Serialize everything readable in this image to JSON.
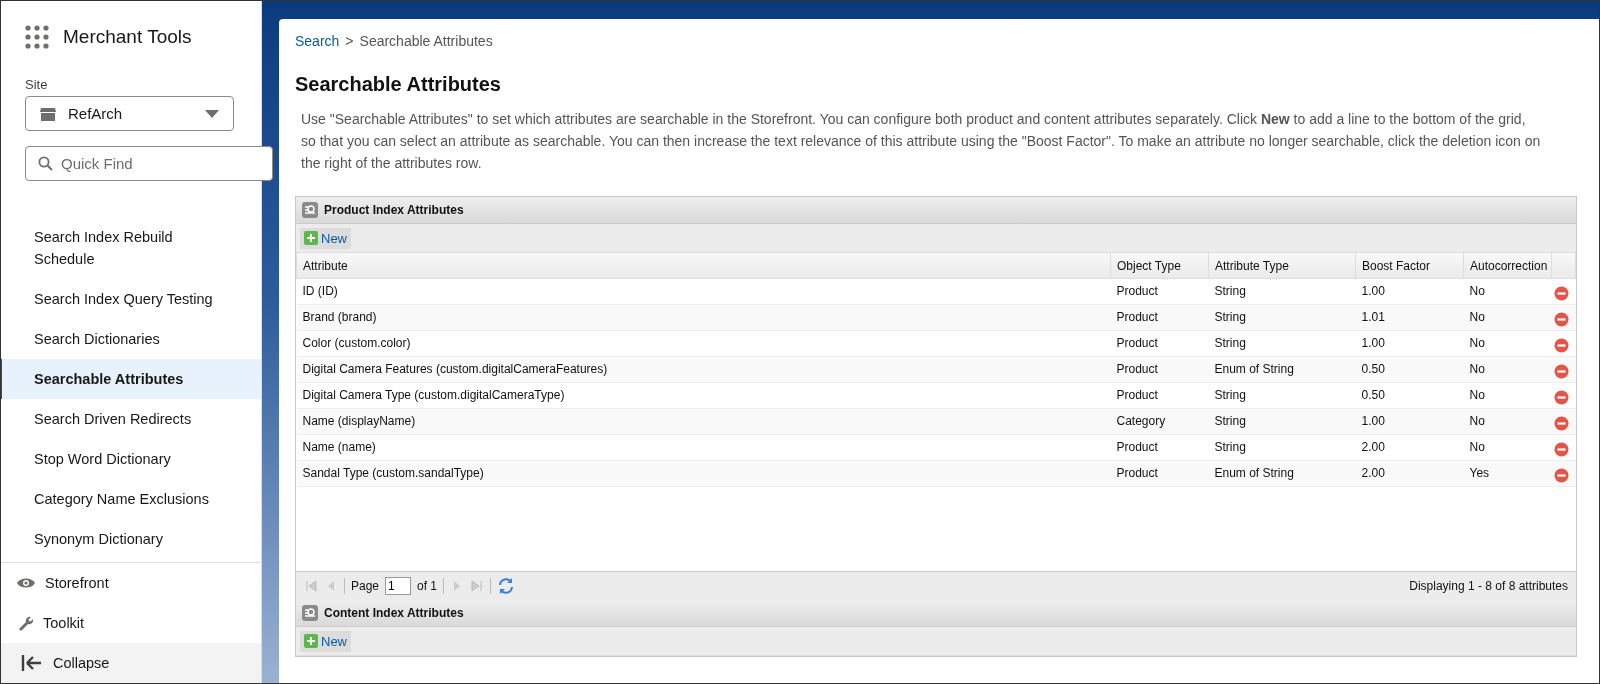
{
  "sidebar": {
    "app_title": "Merchant Tools",
    "site_label": "Site",
    "site_select": {
      "value": "RefArch"
    },
    "quick_find": {
      "placeholder": "Quick Find"
    },
    "items": [
      {
        "label": "Search Index Rebuild Schedule",
        "selected": false
      },
      {
        "label": "Search Index Query Testing",
        "selected": false
      },
      {
        "label": "Search Dictionaries",
        "selected": false
      },
      {
        "label": "Searchable Attributes",
        "selected": true
      },
      {
        "label": "Search Driven Redirects",
        "selected": false
      },
      {
        "label": "Stop Word Dictionary",
        "selected": false
      },
      {
        "label": "Category Name Exclusions",
        "selected": false
      },
      {
        "label": "Synonym Dictionary",
        "selected": false
      }
    ],
    "footer": {
      "storefront": "Storefront",
      "toolkit": "Toolkit",
      "collapse": "Collapse"
    }
  },
  "breadcrumb": {
    "link": "Search",
    "separator": ">",
    "current": "Searchable Attributes"
  },
  "title": "Searchable Attributes",
  "description": "Use \"Searchable Attributes\" to set which attributes are searchable in the Storefront. You can configure both product and content attributes separately. Click **New** to add a line to the bottom of the grid, so that you can select an attribute as searchable. You can then increase the text relevance of this attribute using the \"Boost Factor\". To make an attribute no longer searchable, click the deletion icon on the right of the attributes row.",
  "product_panel": {
    "title": "Product Index Attributes",
    "new_button": "New",
    "columns": [
      "Attribute",
      "Object Type",
      "Attribute Type",
      "Boost Factor",
      "Autocorrection"
    ],
    "rows": [
      [
        "ID (ID)",
        "Product",
        "String",
        "1.00",
        "No"
      ],
      [
        "Brand (brand)",
        "Product",
        "String",
        "1.01",
        "No"
      ],
      [
        "Color (custom.color)",
        "Product",
        "String",
        "1.00",
        "No"
      ],
      [
        "Digital Camera Features (custom.digitalCameraFeatures)",
        "Product",
        "Enum of String",
        "0.50",
        "No"
      ],
      [
        "Digital Camera Type (custom.digitalCameraType)",
        "Product",
        "String",
        "0.50",
        "No"
      ],
      [
        "Name (displayName)",
        "Category",
        "String",
        "1.00",
        "No"
      ],
      [
        "Name (name)",
        "Product",
        "String",
        "2.00",
        "No"
      ],
      [
        "Sandal Type (custom.sandalType)",
        "Product",
        "Enum of String",
        "2.00",
        "Yes"
      ]
    ],
    "pager": {
      "page_label": "Page",
      "page_value": "1",
      "of_label": "of 1",
      "display": "Displaying 1 - 8 of 8 attributes"
    }
  },
  "content_panel": {
    "title": "Content Index Attributes",
    "new_button": "New"
  }
}
